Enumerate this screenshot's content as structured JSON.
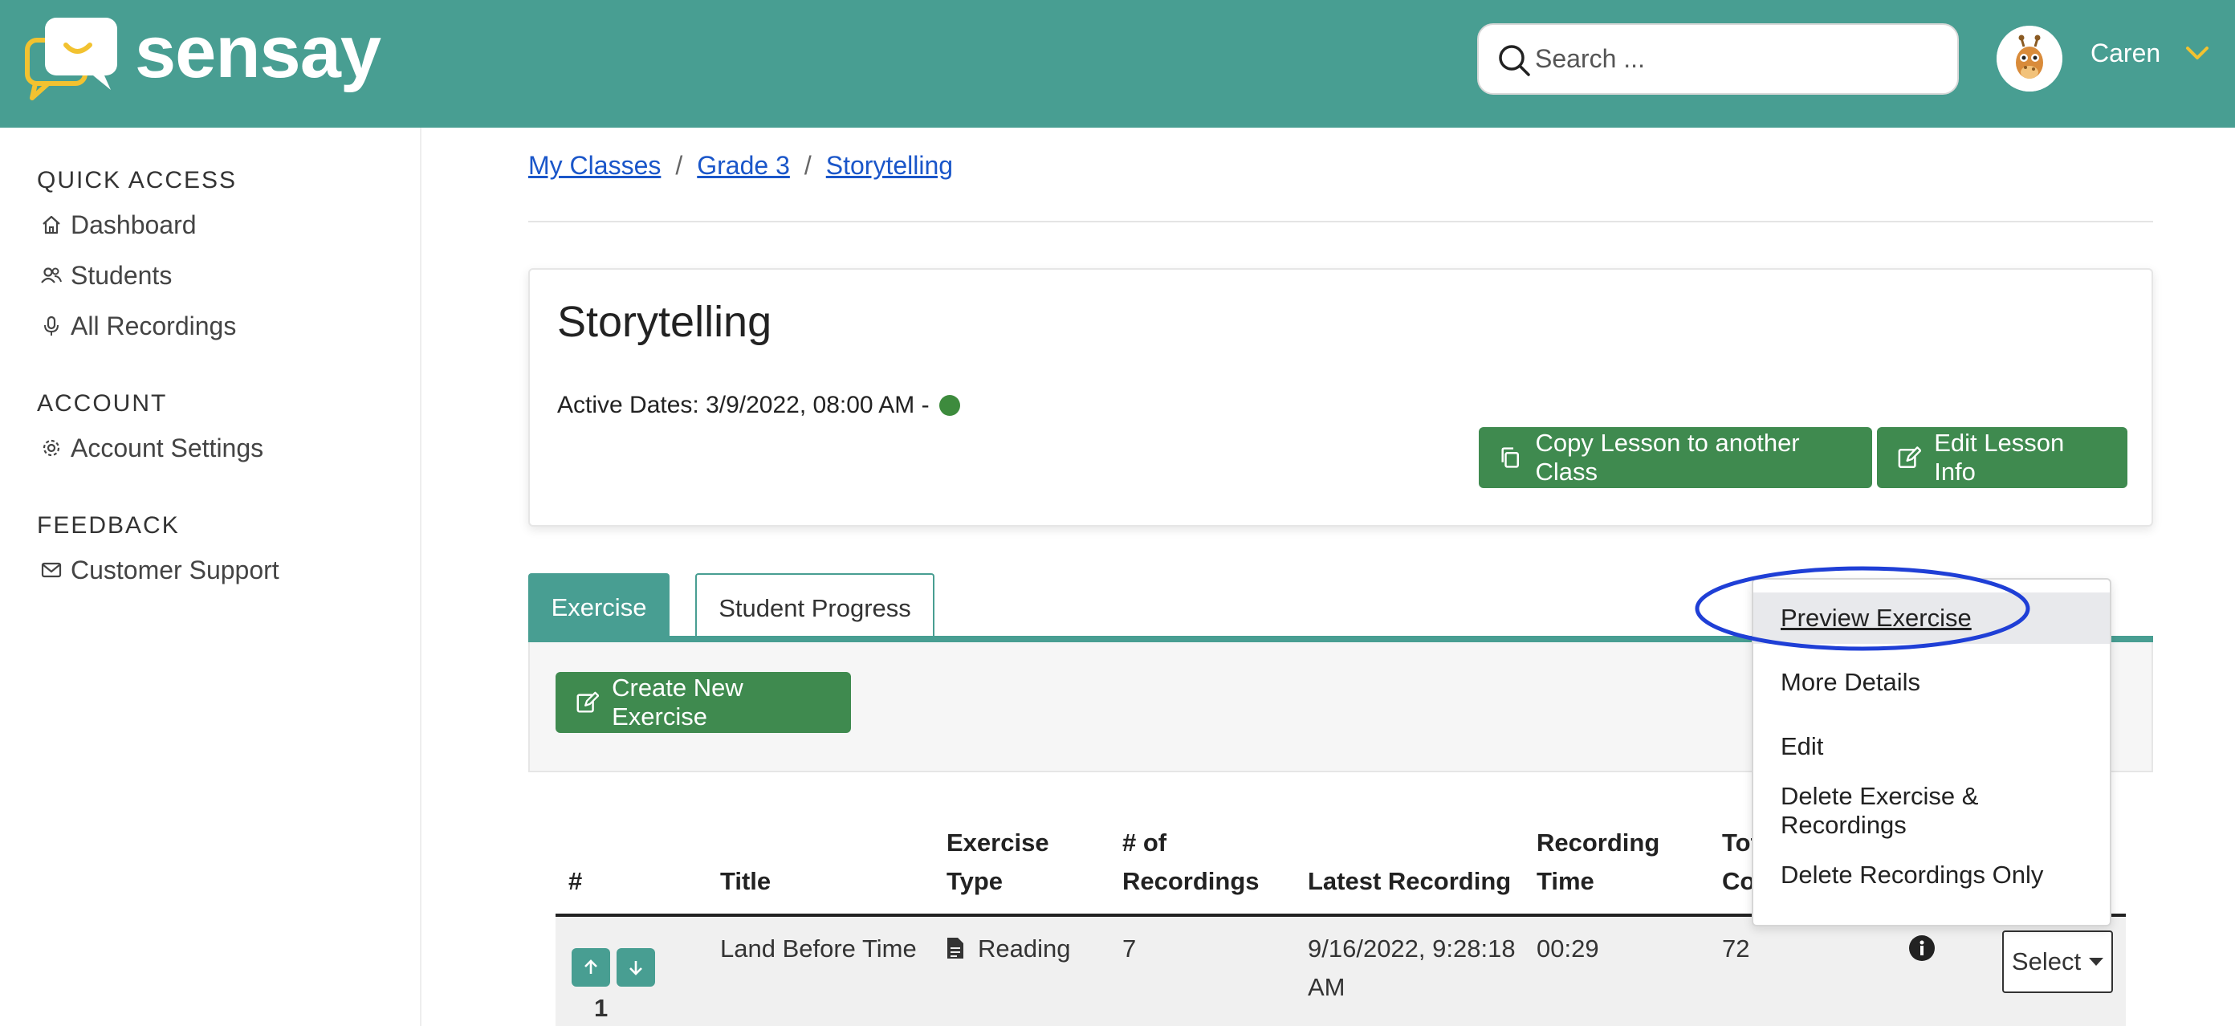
{
  "header": {
    "brand": "sensay",
    "search_placeholder": "Search ...",
    "username": "Caren"
  },
  "sidebar": {
    "sections": [
      {
        "heading": "QUICK ACCESS",
        "items": [
          {
            "label": "Dashboard",
            "icon": "home-icon"
          },
          {
            "label": "Students",
            "icon": "users-icon"
          },
          {
            "label": "All Recordings",
            "icon": "microphone-icon"
          }
        ]
      },
      {
        "heading": "ACCOUNT",
        "items": [
          {
            "label": "Account Settings",
            "icon": "gear-icon"
          }
        ]
      },
      {
        "heading": "FEEDBACK",
        "items": [
          {
            "label": "Customer Support",
            "icon": "mail-icon"
          }
        ]
      }
    ]
  },
  "breadcrumb": [
    "My Classes",
    "Grade 3",
    "Storytelling"
  ],
  "lesson": {
    "title": "Storytelling",
    "active_dates": "Active Dates: 3/9/2022, 08:00 AM -",
    "copy_button": "Copy Lesson to another Class",
    "edit_button": "Edit Lesson Info"
  },
  "tabs": [
    "Exercise",
    "Student Progress"
  ],
  "create_button": "Create New Exercise",
  "table": {
    "headers": {
      "num": "#",
      "title": "Title",
      "type_1": "Exercise",
      "type_2": "Type",
      "rec_1": "# of",
      "rec_2": "Recordings",
      "latest": "Latest Recording",
      "time_1": "Recording",
      "time_2": "Time",
      "total_1": "Tot",
      "total_2": "Co"
    },
    "rows": [
      {
        "num": "1",
        "title": "Land Before Time",
        "type": "Reading",
        "recordings": "7",
        "latest_1": "9/16/2022, 9:28:18",
        "latest_2": "AM",
        "time": "00:29",
        "total": "72",
        "action": "Select"
      }
    ]
  },
  "dropdown": {
    "items": [
      "Preview Exercise",
      "More Details",
      "Edit",
      "Delete Exercise & Recordings",
      "Delete Recordings Only"
    ]
  },
  "colors": {
    "header": "#489e92",
    "button_green": "#3f8a4f",
    "link": "#1a56c9",
    "status_dot": "#3d8b3d",
    "annotation": "#1f3fd6"
  }
}
